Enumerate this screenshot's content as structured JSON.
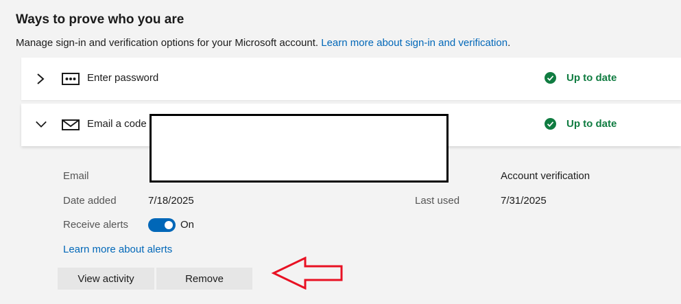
{
  "header": {
    "title": "Ways to prove who you are",
    "description": "Manage sign-in and verification options for your Microsoft account.",
    "learn_more_link": "Learn more about sign-in and verification"
  },
  "methods": [
    {
      "label": "Enter password",
      "icon": "password-dots-icon",
      "status": "Up to date",
      "expanded": false
    },
    {
      "label": "Email a code",
      "icon": "envelope-icon",
      "status": "Up to date",
      "expanded": true
    }
  ],
  "details": {
    "email_label": "Email",
    "used_for_value": "Account verification",
    "date_added_label": "Date added",
    "date_added_value": "7/18/2025",
    "last_used_label": "Last used",
    "last_used_value": "7/31/2025",
    "receive_alerts_label": "Receive alerts",
    "receive_alerts_state": "On",
    "alerts_link": "Learn more about alerts"
  },
  "actions": {
    "view_activity": "View activity",
    "remove": "Remove"
  },
  "colors": {
    "accent": "#0067b8",
    "success": "#107c41",
    "annotation_arrow": "#e81123"
  }
}
